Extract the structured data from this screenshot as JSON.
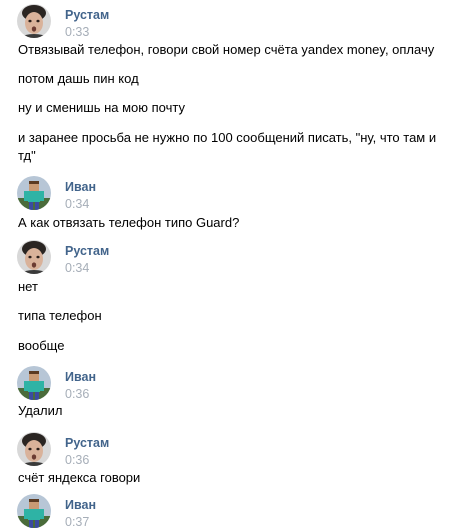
{
  "messages": [
    {
      "author": "Рустам",
      "avatar": "user-avatar-rustam",
      "time": "0:33",
      "lines": [
        "Отвязывай телефон, говори свой номер счёта yandex money, оплачу",
        "потом дашь пин код",
        "ну и сменишь на мою почту",
        "и заранее просьба не нужно по 100 сообщений писать, \"ну, что там и тд\""
      ]
    },
    {
      "author": "Иван",
      "avatar": "user-avatar-ivan",
      "time": "0:34",
      "lines": [
        "А как отвязать телефон типо Guard?"
      ]
    },
    {
      "author": "Рустам",
      "avatar": "user-avatar-rustam",
      "time": "0:34",
      "lines": [
        "нет",
        "типа телефон",
        "вообще"
      ]
    },
    {
      "author": "Иван",
      "avatar": "user-avatar-ivan",
      "time": "0:36",
      "lines": [
        "Удалил"
      ]
    },
    {
      "author": "Рустам",
      "avatar": "user-avatar-rustam",
      "time": "0:36",
      "lines": [
        "счёт яндекса говори"
      ]
    },
    {
      "author": "Иван",
      "avatar": "user-avatar-ivan",
      "time": "0:37",
      "lines": []
    }
  ],
  "colors": {
    "author": "#42648b",
    "time": "#a6aeb8",
    "text": "#000000",
    "background": "#ffffff"
  }
}
